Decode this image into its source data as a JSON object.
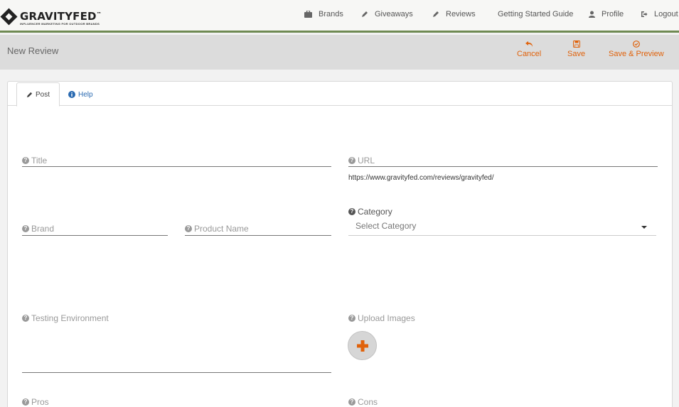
{
  "header": {
    "brand_name": "GRAVITYFED",
    "brand_mark": "™",
    "brand_tagline": "INFLUENCER MARKETING FOR OUTDOOR BRANDS",
    "nav": [
      {
        "label": "Brands",
        "icon": "briefcase-icon"
      },
      {
        "label": "Giveaways",
        "icon": "pencil-icon"
      },
      {
        "label": "Reviews",
        "icon": "pencil-icon"
      },
      {
        "label": "Getting Started Guide",
        "icon": ""
      },
      {
        "label": "Profile",
        "icon": "user-icon"
      },
      {
        "label": "Logout",
        "icon": "logout-icon"
      }
    ]
  },
  "toolbar": {
    "title": "New Review",
    "cancel_label": "Cancel",
    "save_label": "Save",
    "save_preview_label": "Save & Preview"
  },
  "tabs": {
    "post_label": "Post",
    "help_label": "Help"
  },
  "form": {
    "title_label": "Title",
    "url_label": "URL",
    "url_value": "https://www.gravityfed.com/reviews/gravityfed/",
    "brand_label": "Brand",
    "product_label": "Product Name",
    "category_label": "Category",
    "category_placeholder": "Select Category",
    "testing_label": "Testing Environment",
    "upload_label": "Upload Images",
    "pros_label": "Pros",
    "cons_label": "Cons"
  },
  "colors": {
    "accent": "#e0620b",
    "nav_border": "#6f8a53",
    "link": "#2a6ab1",
    "toolbar_bg": "#dcdcdc"
  }
}
